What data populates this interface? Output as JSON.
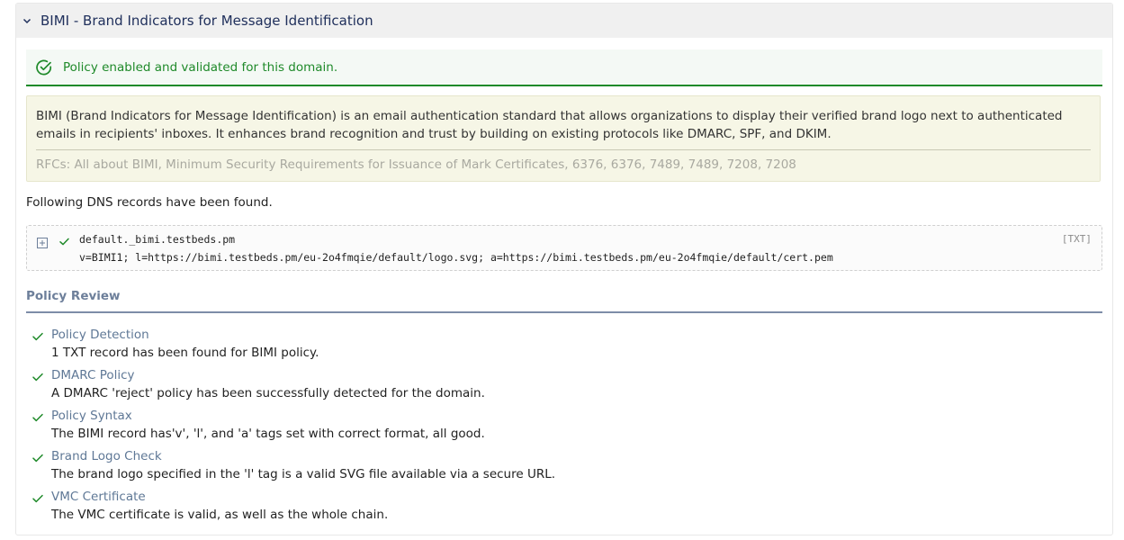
{
  "colors": {
    "success": "#1f8a2a",
    "header_text": "#20305c",
    "link": "#5f7896"
  },
  "panel": {
    "title": "BIMI - Brand Indicators for Message Identification",
    "toggle_icon": "chevron-down-icon"
  },
  "status": {
    "icon": "check-circle-icon",
    "text": "Policy enabled and validated for this domain."
  },
  "info": {
    "description": "BIMI (Brand Indicators for Message Identification) is an email authentication standard that allows organizations to display their verified brand logo next to authenticated emails in recipients' inboxes. It enhances brand recognition and trust by building on existing protocols like DMARC, SPF, and DKIM.",
    "rfcs": "RFCs:  All about BIMI, Minimum Security Requirements for Issuance of Mark Certificates, 6376, 6376, 7489, 7489, 7208, 7208"
  },
  "records": {
    "found_text": "Following DNS records have been found.",
    "items": [
      {
        "name": "default._bimi.testbeds.pm",
        "value": "v=BIMI1; l=https://bimi.testbeds.pm/eu-2o4fmqie/default/logo.svg; a=https://bimi.testbeds.pm/eu-2o4fmqie/default/cert.pem",
        "type": "[TXT]"
      }
    ]
  },
  "review": {
    "title": "Policy Review",
    "items": [
      {
        "title": "Policy Detection",
        "desc": "1 TXT record has been found for BIMI policy."
      },
      {
        "title": "DMARC Policy",
        "desc": "A DMARC 'reject' policy has been successfully detected for the domain."
      },
      {
        "title": "Policy Syntax",
        "desc": "The BIMI record has'v', 'l', and 'a' tags set with correct format, all good."
      },
      {
        "title": "Brand Logo Check",
        "desc": "The brand logo specified in the 'l' tag is a valid SVG file available via a secure URL."
      },
      {
        "title": "VMC Certificate",
        "desc": "The VMC certificate is valid, as well as the whole chain."
      }
    ]
  }
}
